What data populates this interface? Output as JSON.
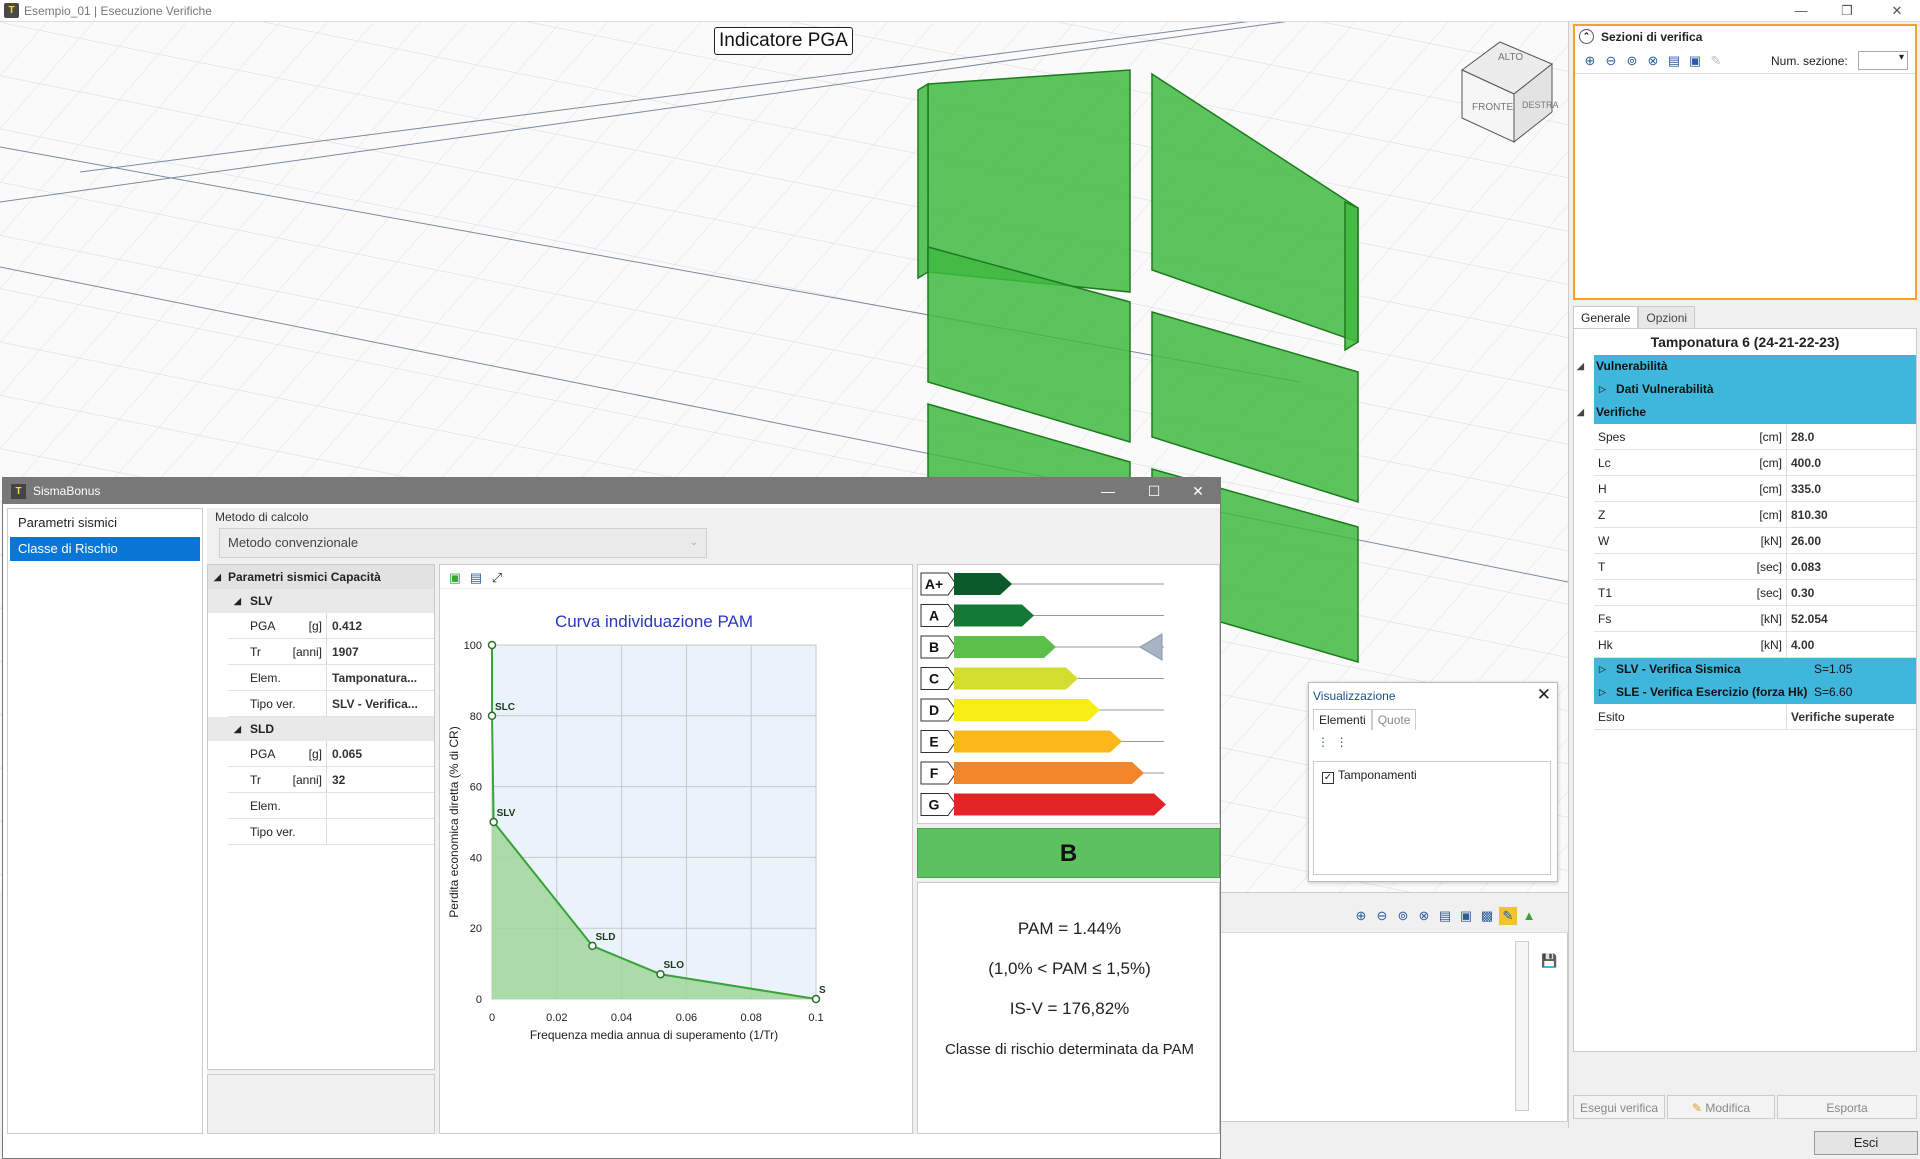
{
  "window": {
    "title": "Esempio_01 | Esecuzione Verifiche",
    "app_icon": "T"
  },
  "viewport": {
    "pga_label": "Indicatore PGA",
    "cube_faces": [
      "ALTO",
      "FRONTE",
      "DESTRA"
    ]
  },
  "sezioni": {
    "title": "Sezioni di verifica",
    "num_label": "Num. sezione:"
  },
  "right_tabs": [
    "Generale",
    "Opzioni"
  ],
  "properties": {
    "title": "Tamponatura 6 (24-21-22-23)",
    "cat_vulnerabilita": "Vulnerabilità",
    "sub_dati_vulnerabilita": "Dati Vulnerabilità",
    "cat_verifiche": "Verifiche",
    "rows": [
      {
        "name": "Spes",
        "unit": "[cm]",
        "value": "28.0"
      },
      {
        "name": "Lc",
        "unit": "[cm]",
        "value": "400.0"
      },
      {
        "name": "H",
        "unit": "[cm]",
        "value": "335.0"
      },
      {
        "name": "Z",
        "unit": "[cm]",
        "value": "810.30"
      },
      {
        "name": "W",
        "unit": "[kN]",
        "value": "26.00"
      },
      {
        "name": "T",
        "unit": "[sec]",
        "value": "0.083"
      },
      {
        "name": "T1",
        "unit": "[sec]",
        "value": "0.30"
      },
      {
        "name": "Fs",
        "unit": "[kN]",
        "value": "52.054"
      },
      {
        "name": "Hk",
        "unit": "[kN]",
        "value": "4.00"
      }
    ],
    "slv_label": "SLV - Verifica Sismica",
    "slv_value": "S=1.05",
    "sle_label": "SLE - Verifica Esercizio (forza Hk)",
    "sle_value": "S=6.60",
    "esito_name": "Esito",
    "esito_value": "Verifiche superate"
  },
  "right_buttons": {
    "esegui": "Esegui verifica",
    "modifica": "Modifica",
    "esporta": "Esporta"
  },
  "esci_label": "Esci",
  "visualizzazione": {
    "title": "Visualizzazione",
    "tab_elementi": "Elementi",
    "tab_quote": "Quote",
    "item": "Tamponamenti",
    "checked": true
  },
  "dialog": {
    "title": "SismaBonus",
    "nav": [
      "Parametri sismici",
      "Classe di Rischio"
    ],
    "nav_selected": 1,
    "metodo_label": "Metodo di calcolo",
    "metodo_value": "Metodo convenzionale",
    "params_header": "Parametri sismici Capacità",
    "slv_header": "SLV",
    "sld_header": "SLD",
    "slv_rows": [
      {
        "name": "PGA",
        "unit": "[g]",
        "value": "0.412"
      },
      {
        "name": "Tr",
        "unit": "[anni]",
        "value": "1907"
      },
      {
        "name": "Elem.",
        "unit": "",
        "value": "Tamponatura..."
      },
      {
        "name": "Tipo ver.",
        "unit": "",
        "value": "SLV - Verifica..."
      }
    ],
    "sld_rows": [
      {
        "name": "PGA",
        "unit": "[g]",
        "value": "0.065"
      },
      {
        "name": "Tr",
        "unit": "[anni]",
        "value": "32"
      },
      {
        "name": "Elem.",
        "unit": "",
        "value": ""
      },
      {
        "name": "Tipo ver.",
        "unit": "",
        "value": ""
      }
    ]
  },
  "chart_data": {
    "type": "area",
    "title": "Curva individuazione PAM",
    "xlabel": "Frequenza media annua di superamento (1/Tr)",
    "ylabel": "Perdita economica diretta (% di CR)",
    "xlim": [
      0,
      0.1
    ],
    "ylim": [
      0,
      100
    ],
    "x_ticks": [
      "0",
      "0.02",
      "0.04",
      "0.06",
      "0.08",
      "0.1"
    ],
    "y_ticks": [
      "0",
      "20",
      "40",
      "60",
      "80",
      "100"
    ],
    "grid": true,
    "points": [
      {
        "x": 0.0,
        "y": 100,
        "label": ""
      },
      {
        "x": 0.0,
        "y": 80,
        "label": "SLC"
      },
      {
        "x": 0.0005,
        "y": 50,
        "label": "SLV"
      },
      {
        "x": 0.031,
        "y": 15,
        "label": "SLD"
      },
      {
        "x": 0.052,
        "y": 7,
        "label": "SLO"
      },
      {
        "x": 0.1,
        "y": 0,
        "label": "S"
      }
    ],
    "fill_color": "#9fd69a",
    "line_color": "#3aa23a"
  },
  "risk_classes": {
    "labels": [
      "A+",
      "A",
      "B",
      "C",
      "D",
      "E",
      "F",
      "G"
    ],
    "colors": [
      "#0a5a2a",
      "#137a36",
      "#5bbf4a",
      "#d2dd2e",
      "#f7ee15",
      "#fbb81a",
      "#f3862a",
      "#e32427"
    ],
    "selected": "B"
  },
  "result": {
    "class_letter": "B",
    "class_color": "#5ec160",
    "pam": "PAM = 1.44%",
    "pam_range": "(1,0% < PAM ≤ 1,5%)",
    "isv": "IS-V = 176,82%",
    "note": "Classe di rischio determinata da PAM"
  }
}
